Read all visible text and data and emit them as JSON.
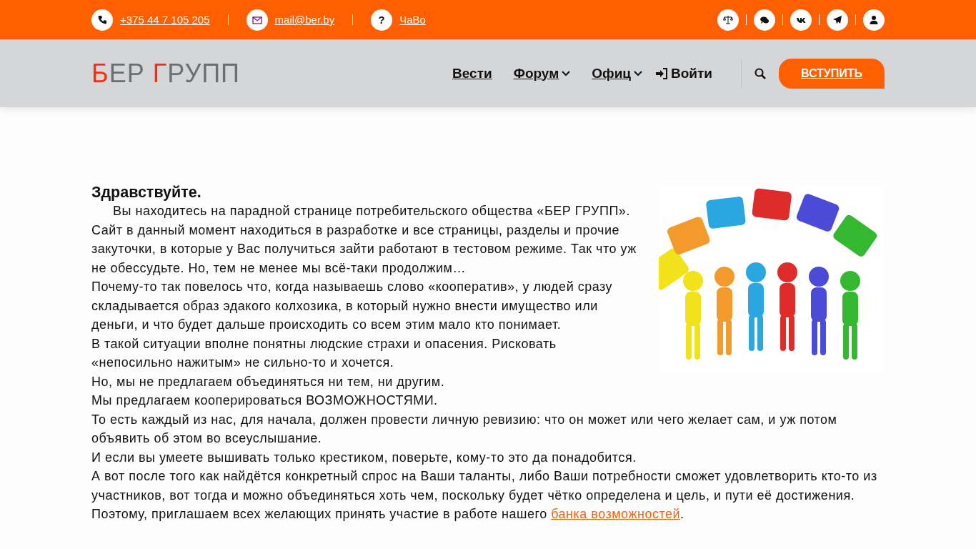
{
  "topbar": {
    "contacts": [
      {
        "kind": "phone",
        "text": "+375 44 7 105 205"
      },
      {
        "kind": "mail",
        "text": "mail@ber.by"
      },
      {
        "kind": "faq",
        "text": "ЧаВо",
        "icon": "?"
      }
    ],
    "social": [
      {
        "kind": "scales"
      },
      {
        "kind": "chat"
      },
      {
        "kind": "vk"
      },
      {
        "kind": "telegram"
      },
      {
        "kind": "user"
      }
    ]
  },
  "header": {
    "logo": [
      {
        "text": "Б",
        "accent": true
      },
      {
        "text": "ЕР ",
        "accent": false
      },
      {
        "text": "Г",
        "accent": true
      },
      {
        "text": "РУПП",
        "accent": false
      }
    ],
    "nav": [
      {
        "label": "Вести",
        "kind": "link"
      },
      {
        "label": "Форум",
        "kind": "dropdown"
      },
      {
        "label": "Офиц",
        "kind": "dropdown"
      },
      {
        "label": "Войти",
        "kind": "login"
      }
    ],
    "join_button": "ВСТУПИТЬ"
  },
  "article": {
    "heading": "Здравствуйте.",
    "intro": [
      {
        "text": "Вы находитесь на парадной странице потребительского общества «БЕР ГРУПП». Сайт в данный момент находиться в разработке и все страницы, разделы и прочие закуточки, в которые у Вас получиться зайти работают в тестовом режиме. Так что уж не обессудьте. Но, тем не менее мы всё-таки продолжим…",
        "indent": true
      },
      {
        "text": "Почему-то так повелось что, когда называешь слово «кооператив», у людей сразу складывается образ эдакого колхозика, в который нужно внести имущество или деньги, и что будет дальше происходить со всем этим мало кто понимает.",
        "indent": false
      },
      {
        "text": "В такой ситуации вполне понятны людские страхи и опасения. Рисковать «непосильно нажитым» не сильно-то и хочется.",
        "indent": false
      }
    ],
    "paragraphs": [
      {
        "text": "Но, мы не предлагаем объединяться ни тем, ни другим.",
        "indent": false
      },
      {
        "text": "Мы предлагаем кооперироваться ВОЗМОЖНОСТЯМИ.",
        "indent": false
      },
      {
        "text": "То есть каждый из нас, для начала, должен провести личную ревизию: что он может или чего желает сам, и уж потом объявить об этом во всеуслышание.",
        "indent": false
      },
      {
        "text": "И если вы умеете вышивать только крестиком, поверьте, кому-то это да понадобится.",
        "indent": false
      },
      {
        "text": "А вот после того как найдётся конкретный спрос на Ваши таланты, либо Ваши потребности сможет удовлетворить кто-то из участников, вот тогда и можно объединяться хоть чем, поскольку будет чётко определена и цель, и пути её достижения.",
        "indent": false
      }
    ],
    "closing": {
      "text": "Поэтому, приглашаем всех желающих принять участие в работе нашего ",
      "link": "банка возможностей",
      "after": "."
    }
  }
}
